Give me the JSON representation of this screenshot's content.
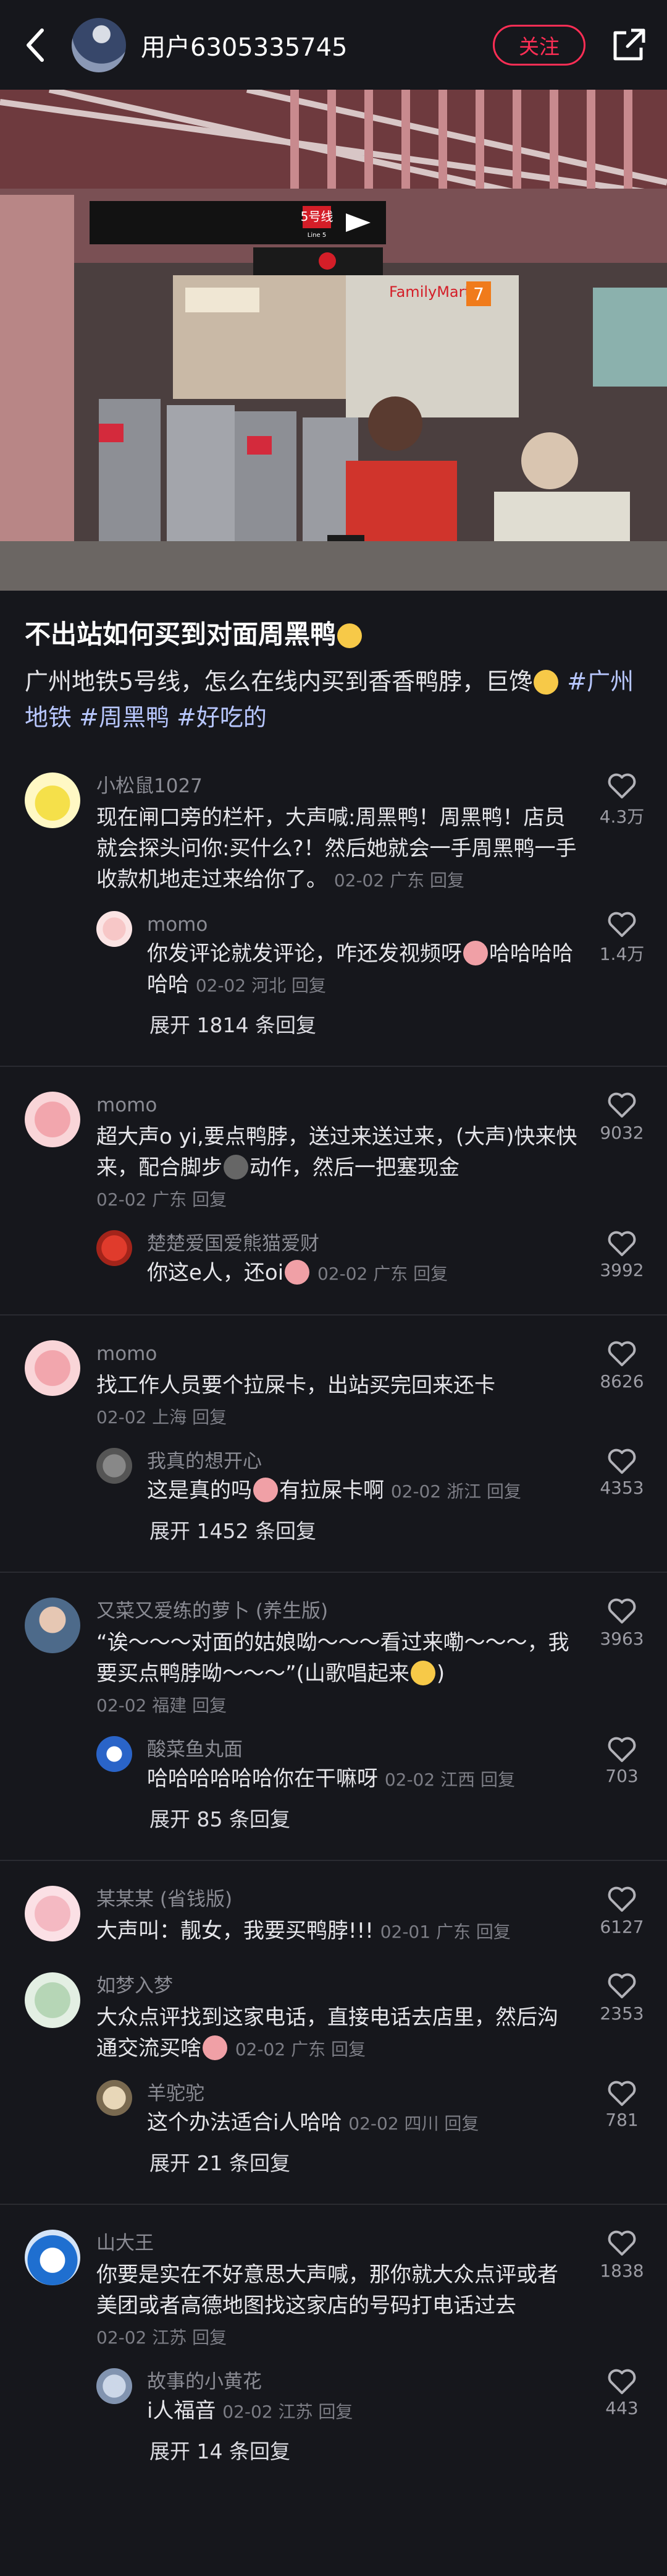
{
  "header": {
    "username": "用户6305335745",
    "follow_label": "关注"
  },
  "photo": {
    "sign_line": "5号线",
    "sign_line_en": "Line 5",
    "shop_sign": "FamilyMart",
    "shop_sign2": "7"
  },
  "post": {
    "title": "不出站如何买到对面周黑鸭",
    "desc_text": "广州地铁5号线，怎么在线内买到香香鸭脖，巨馋",
    "tags": [
      "#广州地铁",
      "#周黑鸭",
      "#好吃的"
    ]
  },
  "comments": [
    {
      "name": "小松鼠1027",
      "text": "现在闸口旁的栏杆，大声喊:周黑鸭！周黑鸭！店员就会探头问你:买什么?！然后她就会一手周黑鸭一手收款机地走过来给你了。",
      "meta": "02-02 广东 回复",
      "likes": "4.3万",
      "reply": {
        "name": "momo",
        "text": "你发评论就发评论，咋还发视频呀",
        "text2": "哈哈哈哈哈哈",
        "meta": "02-02 河北 回复",
        "likes": "1.4万"
      },
      "expand": "展开 1814 条回复"
    },
    {
      "name": "momo",
      "text": "超大声o yi,要点鸭脖，送过来送过来，(大声)快来快来，配合脚步",
      "text2": "动作，然后一把塞现金",
      "meta": "02-02 广东 回复",
      "likes": "9032",
      "reply": {
        "name": "楚楚爱国爱熊猫爱财",
        "text": "你这e人，还oi",
        "meta": "02-02 广东 回复",
        "likes": "3992"
      },
      "expand": ""
    },
    {
      "name": "momo",
      "text": "找工作人员要个拉屎卡，出站买完回来还卡",
      "meta": "02-02 上海 回复",
      "likes": "8626",
      "reply": {
        "name": "我真的想开心",
        "text": "这是真的吗",
        "text2": "有拉屎卡啊",
        "meta": "02-02 浙江 回复",
        "likes": "4353"
      },
      "expand": "展开 1452 条回复"
    },
    {
      "name": "又菜又爱练的萝卜 (养生版)",
      "text": "“诶～～～对面的姑娘呦～～～看过来嘞～～～，我要买点鸭脖呦～～～”(山歌唱起来",
      "text2": ")",
      "meta": "02-02 福建 回复",
      "likes": "3963",
      "reply": {
        "name": "酸菜鱼丸面",
        "text": "哈哈哈哈哈哈你在干嘛呀",
        "meta": "02-02 江西 回复",
        "likes": "703"
      },
      "expand": "展开 85 条回复"
    },
    {
      "name": "某某某 (省钱版)",
      "text": "大声叫：靓女，我要买鸭脖!!!",
      "meta": "02-01 广东 回复",
      "likes": "6127",
      "reply": null,
      "expand": ""
    },
    {
      "name": "如梦入梦",
      "text": "大众点评找到这家电话，直接电话去店里，然后沟通交流买啥",
      "meta": "02-02 广东 回复",
      "likes": "2353",
      "reply": {
        "name": "羊驼驼",
        "text": "这个办法适合i人哈哈",
        "meta": "02-02 四川 回复",
        "likes": "781"
      },
      "expand": "展开 21 条回复"
    },
    {
      "name": "山大王",
      "text": "你要是实在不好意思大声喊，那你就大众点评或者美团或者高德地图找这家店的号码打电话过去",
      "meta": "02-02 江苏 回复",
      "likes": "1838",
      "reply": {
        "name": "故事的小黄花",
        "text": "i人福音",
        "meta": "02-02 江苏 回复",
        "likes": "443"
      },
      "expand": "展开 14 条回复"
    }
  ]
}
